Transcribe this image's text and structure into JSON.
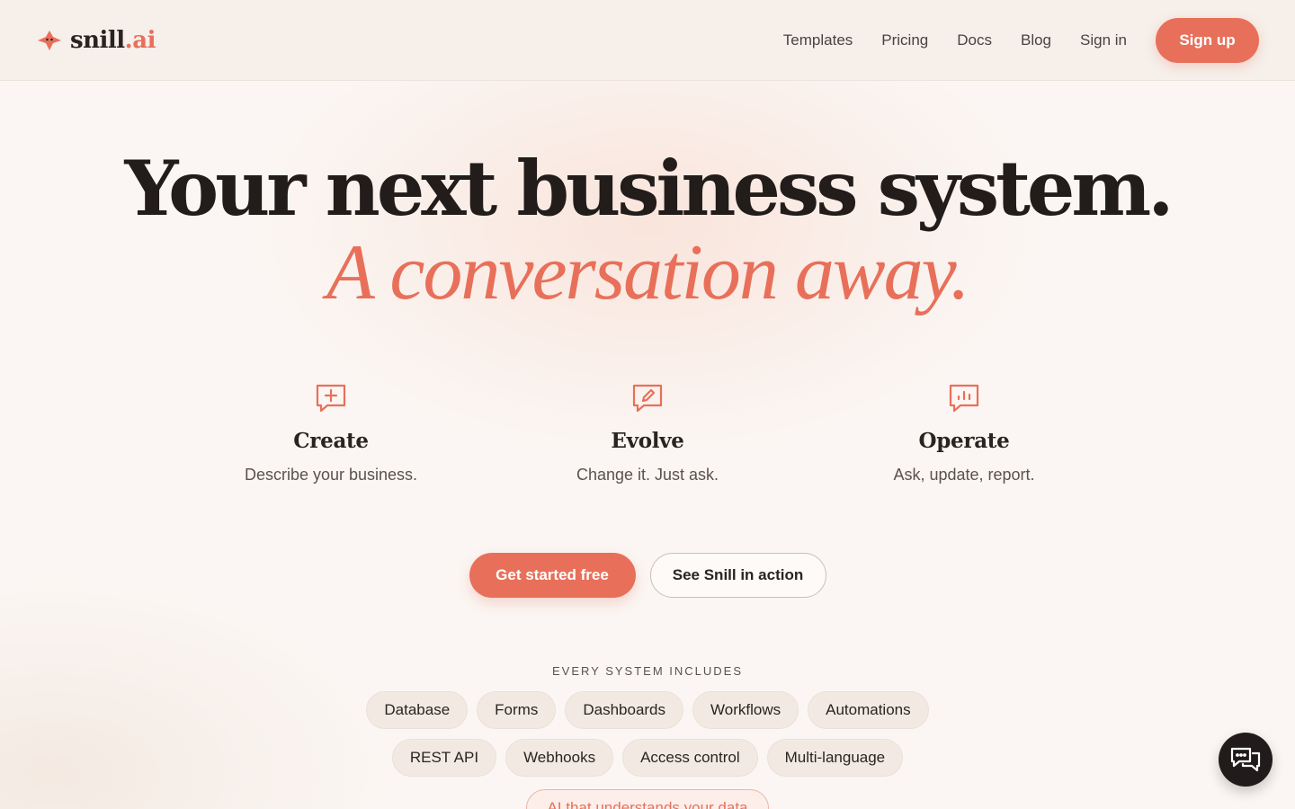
{
  "brand": {
    "name": "snill",
    "ext": ".ai"
  },
  "nav": {
    "items": [
      {
        "label": "Templates"
      },
      {
        "label": "Pricing"
      },
      {
        "label": "Docs"
      },
      {
        "label": "Blog"
      },
      {
        "label": "Sign in"
      }
    ],
    "signup_label": "Sign up"
  },
  "hero": {
    "line1": "Your next business system.",
    "line2": "A conversation away."
  },
  "features": [
    {
      "icon": "message-plus-icon",
      "title": "Create",
      "desc": "Describe your business."
    },
    {
      "icon": "pencil-square-icon",
      "title": "Evolve",
      "desc": "Change it. Just ask."
    },
    {
      "icon": "message-chart-icon",
      "title": "Operate",
      "desc": "Ask, update, report."
    }
  ],
  "cta": {
    "primary": "Get started free",
    "secondary": "See Snill in action"
  },
  "includes": {
    "label": "EVERY SYSTEM INCLUDES",
    "row1": [
      "Database",
      "Forms",
      "Dashboards",
      "Workflows",
      "Automations"
    ],
    "row2": [
      "REST API",
      "Webhooks",
      "Access control",
      "Multi-language"
    ],
    "ai_chip": "AI that understands your data"
  },
  "colors": {
    "accent": "#e8705a",
    "text": "#2a2421",
    "background": "#fbf6f3"
  }
}
